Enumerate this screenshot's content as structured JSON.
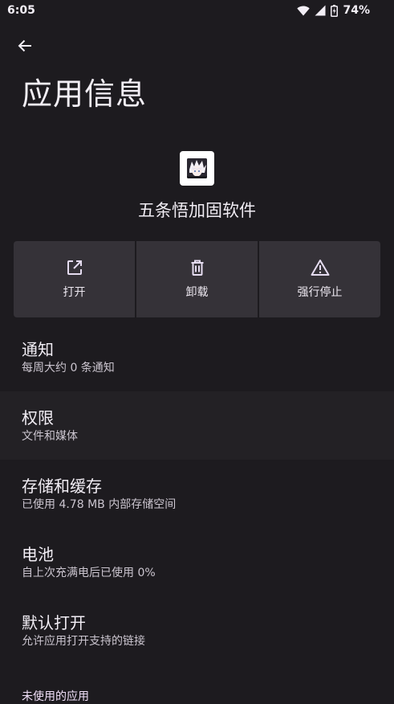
{
  "status_bar": {
    "time": "6:05",
    "battery": "74%"
  },
  "header": {
    "title": "应用信息"
  },
  "app": {
    "name": "五条悟加固软件"
  },
  "actions": [
    {
      "label": "打开",
      "icon": "open-external-icon"
    },
    {
      "label": "卸载",
      "icon": "trash-icon"
    },
    {
      "label": "强行停止",
      "icon": "warning-icon"
    }
  ],
  "settings": [
    {
      "title": "通知",
      "subtitle": "每周大约 0 条通知"
    },
    {
      "title": "权限",
      "subtitle": "文件和媒体"
    },
    {
      "title": "存储和缓存",
      "subtitle": "已使用 4.78 MB 内部存储空间"
    },
    {
      "title": "电池",
      "subtitle": "自上次充满电后已使用 0%"
    },
    {
      "title": "默认打开",
      "subtitle": "允许应用打开支持的链接"
    }
  ],
  "section": {
    "unused_apps": "未使用的应用"
  },
  "colors": {
    "background": "#1d1b1f",
    "button": "#353238",
    "icon": "#e5dcf0"
  }
}
